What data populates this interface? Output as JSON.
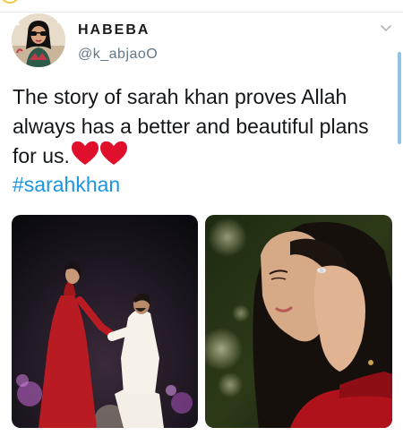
{
  "tweet": {
    "author_name": "HABEBA",
    "author_handle": "@k_abjaoO",
    "text": "The story of sarah khan proves Allah always has a better and beautiful plans for us.",
    "emoji": "❤️❤️",
    "hashtag": "#sarahkhan"
  },
  "icons": {
    "menu": "chevron-down-icon",
    "hearts": "red-heart-icon"
  },
  "colors": {
    "hashtag": "#1b95e0",
    "handle": "#657786",
    "heart": "#e0102d",
    "scroll_indicator": "#8fc3e8"
  },
  "media": [
    {
      "subject": "proposal-photo"
    },
    {
      "subject": "portrait-photo"
    }
  ]
}
